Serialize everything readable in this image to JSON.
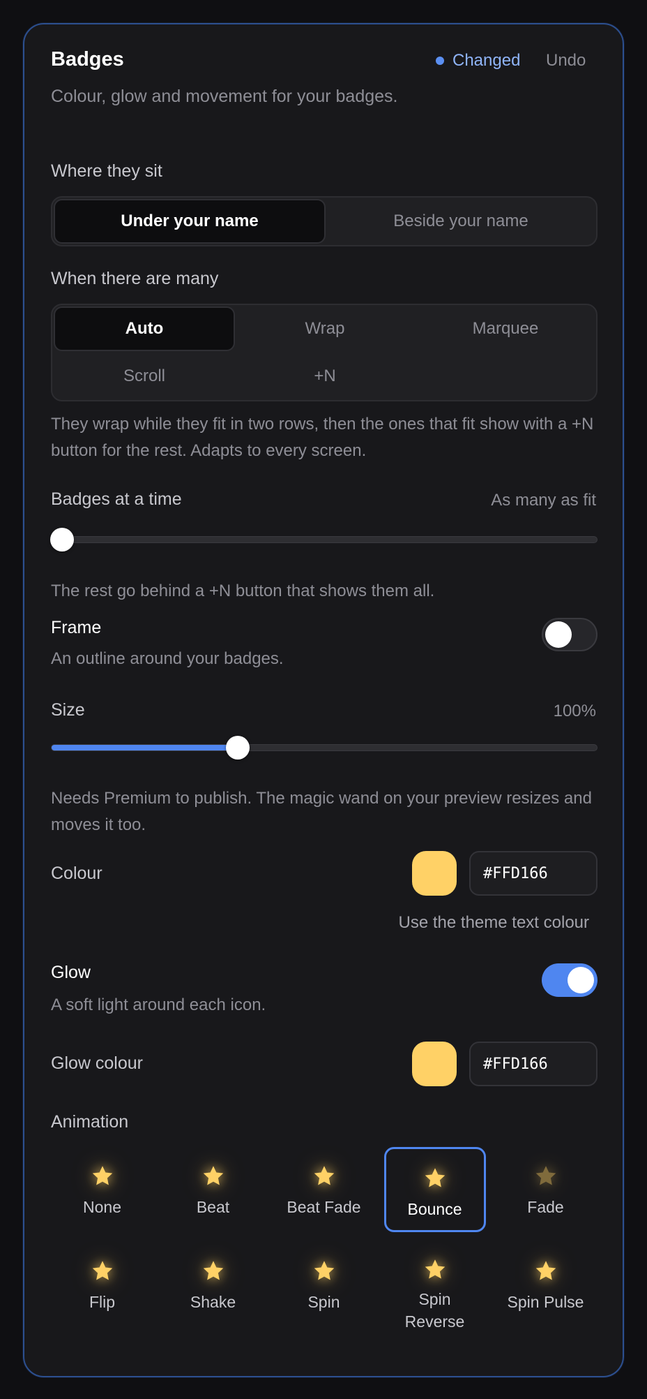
{
  "header": {
    "title": "Badges",
    "status_label": "Changed",
    "undo_label": "Undo",
    "subtitle": "Colour, glow and movement for your badges.",
    "status_color": "#5b8ff2"
  },
  "placement": {
    "label": "Where they sit",
    "options": [
      "Under your name",
      "Beside your name"
    ],
    "selected": "Under your name"
  },
  "overflow": {
    "label": "When there are many",
    "options": [
      "Auto",
      "Wrap",
      "Marquee",
      "Scroll",
      "+N"
    ],
    "selected": "Auto",
    "help": "They wrap while they fit in two rows, then the ones that fit show with a +N button for the rest. Adapts to every screen."
  },
  "count": {
    "label": "Badges at a time",
    "value_label": "As many as fit",
    "slider_value": 0,
    "help": "The rest go behind a +N button that shows them all."
  },
  "frame": {
    "label": "Frame",
    "help": "An outline around your badges.",
    "enabled": false
  },
  "size": {
    "label": "Size",
    "value_label": "100%",
    "slider_fraction": 0.34,
    "help": "Needs Premium to publish. The magic wand on your preview resizes and moves it too."
  },
  "colour": {
    "label": "Colour",
    "hex": "#FFD166",
    "theme_link": "Use the theme text colour"
  },
  "glow": {
    "label": "Glow",
    "help": "A soft light around each icon.",
    "enabled": true
  },
  "glow_colour": {
    "label": "Glow colour",
    "hex": "#FFD166"
  },
  "animation": {
    "label": "Animation",
    "selected": "Bounce",
    "options": [
      {
        "label": "None",
        "icon": "star-icon"
      },
      {
        "label": "Beat",
        "icon": "star-icon"
      },
      {
        "label": "Beat Fade",
        "icon": "star-icon"
      },
      {
        "label": "Bounce",
        "icon": "star-icon"
      },
      {
        "label": "Fade",
        "icon": "star-icon"
      },
      {
        "label": "Flip",
        "icon": "star-icon"
      },
      {
        "label": "Shake",
        "icon": "star-icon"
      },
      {
        "label": "Spin",
        "icon": "star-icon"
      },
      {
        "label": "Spin Reverse",
        "icon": "star-icon"
      },
      {
        "label": "Spin Pulse",
        "icon": "star-icon"
      }
    ]
  },
  "colors": {
    "accent": "#4f86f0",
    "star": "#FFD166"
  }
}
